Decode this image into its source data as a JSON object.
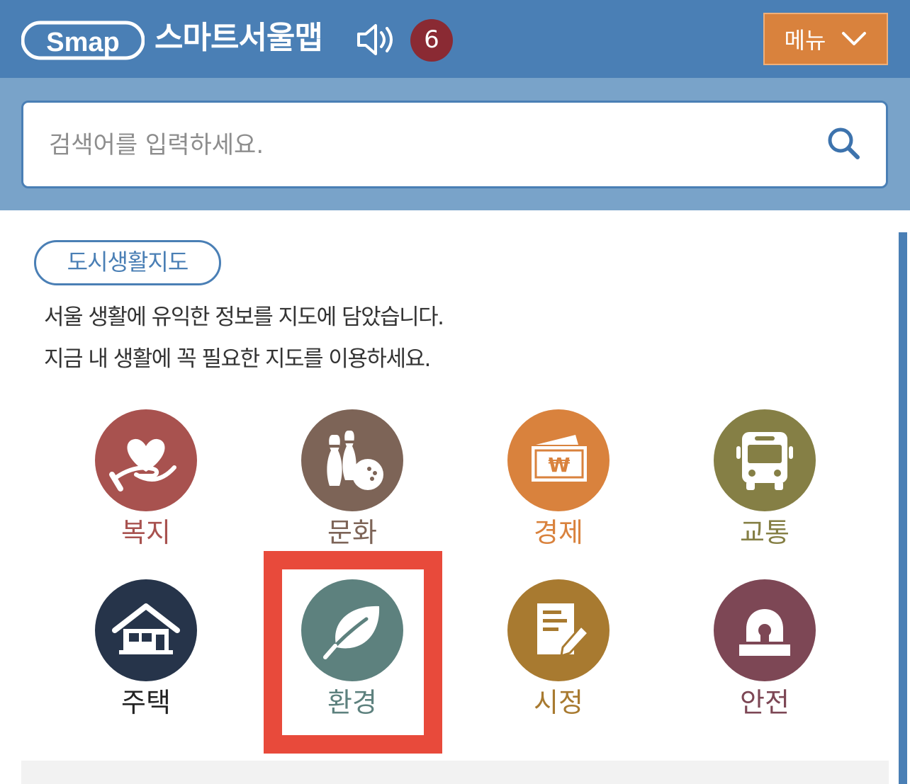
{
  "header": {
    "logo_text": "Smap",
    "title": "스마트서울맵",
    "badge_count": "6",
    "menu_label": "메뉴",
    "bg_color": "#4a7fb5"
  },
  "search": {
    "placeholder": "검색어를 입력하세요."
  },
  "section": {
    "tag": "도시생활지도",
    "description_line1": "서울 생활에 유익한 정보를 지도에 담았습니다.",
    "description_line2": "지금 내 생활에 꼭 필요한 지도를 이용하세요."
  },
  "categories": [
    {
      "label": "복지",
      "icon": "heart-hand-icon",
      "color": "#a8524f",
      "text_color": "#a8524f"
    },
    {
      "label": "문화",
      "icon": "bowling-icon",
      "color": "#7d6457",
      "text_color": "#7d6457"
    },
    {
      "label": "경제",
      "icon": "won-wallet-icon",
      "color": "#d9823d",
      "text_color": "#d9823d"
    },
    {
      "label": "교통",
      "icon": "bus-icon",
      "color": "#857f45",
      "text_color": "#857f45"
    },
    {
      "label": "주택",
      "icon": "house-icon",
      "color": "#26344a",
      "text_color": "#222222"
    },
    {
      "label": "환경",
      "icon": "leaf-icon",
      "color": "#5d817e",
      "text_color": "#5d817e"
    },
    {
      "label": "시정",
      "icon": "document-pen-icon",
      "color": "#a87a30",
      "text_color": "#a87a30"
    },
    {
      "label": "안전",
      "icon": "siren-icon",
      "color": "#7d4755",
      "text_color": "#7d4755"
    }
  ],
  "highlight": {
    "target": "환경",
    "color": "#e84a3b"
  }
}
